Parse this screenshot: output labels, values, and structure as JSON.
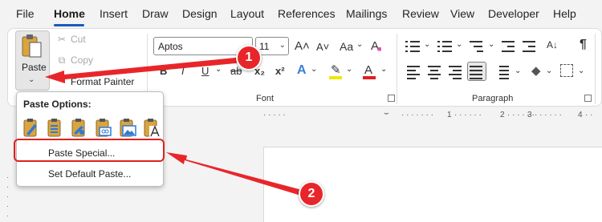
{
  "menu": {
    "tabs": [
      {
        "label": "File"
      },
      {
        "label": "Home"
      },
      {
        "label": "Insert"
      },
      {
        "label": "Draw"
      },
      {
        "label": "Design"
      },
      {
        "label": "Layout"
      },
      {
        "label": "References"
      },
      {
        "label": "Mailings"
      },
      {
        "label": "Review"
      },
      {
        "label": "View"
      },
      {
        "label": "Developer"
      },
      {
        "label": "Help"
      }
    ],
    "active_tab": "Home"
  },
  "clipboard": {
    "paste_label": "Paste",
    "cut_label": "Cut",
    "copy_label": "Copy",
    "format_painter_label": "Format Painter"
  },
  "font": {
    "font_name": "Aptos",
    "font_size": "11",
    "group_label": "Font",
    "grow_glyph": "A˄",
    "shrink_glyph": "A˅",
    "case_glyph": "Aa",
    "clear_glyph": "A",
    "bold_glyph": "B",
    "italic_glyph": "I",
    "underline_glyph": "U",
    "strike_glyph": "ab",
    "subscript_glyph": "x₂",
    "superscript_glyph": "x²",
    "effects_glyph": "A",
    "highlight_glyph": "✎",
    "font_color_glyph": "A",
    "highlight_color": "#f0e60a",
    "font_color": "#e02020"
  },
  "paragraph": {
    "group_label": "Paragraph",
    "marks_glyph": "¶",
    "sort_glyph": "A↓",
    "shading_glyph": "◆"
  },
  "ruler": {
    "labels": [
      "1",
      "2",
      "3",
      "4"
    ]
  },
  "paste_options": {
    "heading": "Paste Options:",
    "items": [
      {
        "label": "Paste Special..."
      },
      {
        "label": "Set Default Paste..."
      }
    ]
  },
  "annotations": {
    "callout_1": "1",
    "callout_2": "2",
    "color": "#e8262a"
  },
  "colors": {
    "accent": "#185abd",
    "paste_icon_blue": "#2e7bd6",
    "clipboard_gold": "#d9a441"
  }
}
